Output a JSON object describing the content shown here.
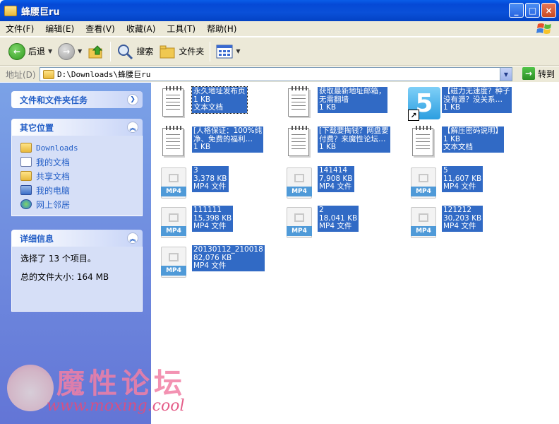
{
  "window": {
    "title": "蜂腰巨ru",
    "btn_min": "_",
    "btn_max": "□",
    "btn_close": "×"
  },
  "menu": [
    "文件(F)",
    "编辑(E)",
    "查看(V)",
    "收藏(A)",
    "工具(T)",
    "帮助(H)"
  ],
  "toolbar": {
    "back": "后退",
    "search": "搜索",
    "folders": "文件夹"
  },
  "address": {
    "label": "地址(D)",
    "path": "D:\\Downloads\\蜂腰巨ru",
    "goto": "转到"
  },
  "left": {
    "tasks_title": "文件和文件夹任务",
    "places_title": "其它位置",
    "places": [
      {
        "label": "Downloads",
        "icon": "folder-icon"
      },
      {
        "label": "我的文档",
        "icon": "documents-icon"
      },
      {
        "label": "共享文档",
        "icon": "folder-icon"
      },
      {
        "label": "我的电脑",
        "icon": "computer-icon"
      },
      {
        "label": "网上邻居",
        "icon": "network-icon"
      }
    ],
    "details_title": "详细信息",
    "details_selected": "选择了 13 个项目。",
    "details_size": "总的文件大小: 164 MB"
  },
  "files": [
    {
      "type": "txt",
      "lines": [
        "永久地址发布页",
        "1 KB",
        "文本文档"
      ]
    },
    {
      "type": "txt",
      "lines": [
        "获取最新地址邮箱，",
        "无需翻墙",
        "1 KB"
      ]
    },
    {
      "type": "url",
      "lines": [
        "【磁力无速度？种子",
        "没有源？没关系…",
        "1 KB"
      ]
    },
    {
      "type": "txt",
      "lines": [
        "[人格保证：100%纯",
        "净、免费的福利…",
        "1 KB"
      ]
    },
    {
      "type": "txt",
      "lines": [
        "[下载要掏钱？网盘要",
        "付费？来魔性论坛…",
        "1 KB"
      ]
    },
    {
      "type": "txt",
      "lines": [
        "【解压密码说明】",
        "1 KB",
        "文本文档"
      ]
    },
    {
      "type": "mp4",
      "lines": [
        "3",
        "3,378 KB",
        "MP4 文件"
      ]
    },
    {
      "type": "mp4",
      "lines": [
        "141414",
        "7,908 KB",
        "MP4 文件"
      ]
    },
    {
      "type": "mp4",
      "lines": [
        "5",
        "11,607 KB",
        "MP4 文件"
      ]
    },
    {
      "type": "mp4",
      "lines": [
        "111111",
        "15,398 KB",
        "MP4 文件"
      ]
    },
    {
      "type": "mp4",
      "lines": [
        "2",
        "18,041 KB",
        "MP4 文件"
      ]
    },
    {
      "type": "mp4",
      "lines": [
        "121212",
        "30,203 KB",
        "MP4 文件"
      ]
    },
    {
      "type": "mp4",
      "lines": [
        "20130112_210018",
        "82,076 KB",
        "MP4 文件"
      ]
    }
  ],
  "icons": {
    "mp4_tag": "MP4",
    "url_glyph": "5",
    "shortcut_arrow": "↗"
  },
  "watermark": {
    "title": "魔性论坛",
    "url": "www.moxing.cool"
  }
}
